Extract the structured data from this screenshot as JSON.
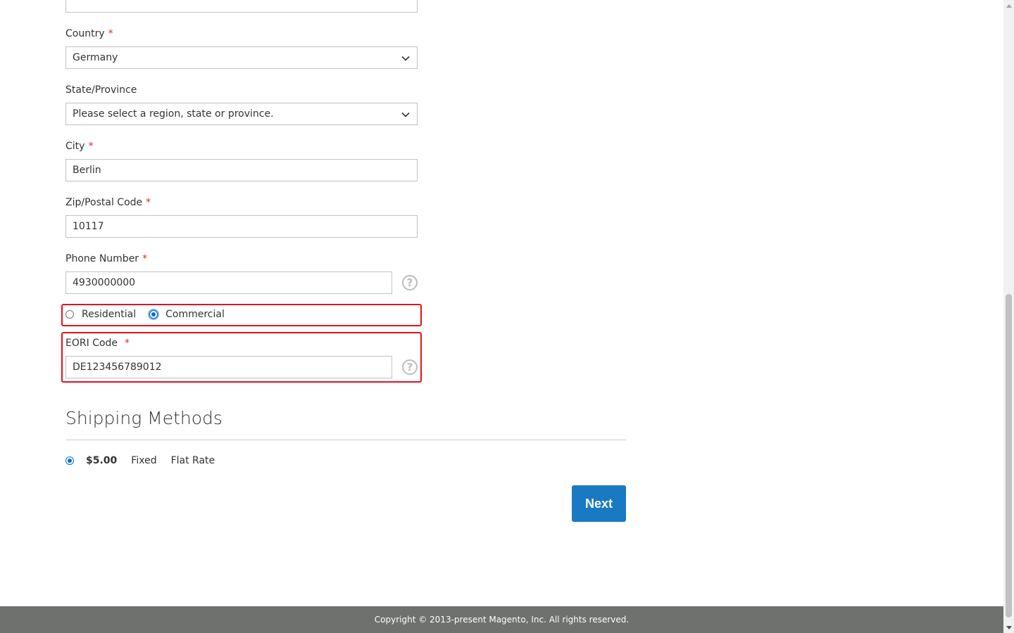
{
  "form": {
    "top_input_value": "",
    "country": {
      "label": "Country",
      "required_mark": "*",
      "value": "Germany"
    },
    "state": {
      "label": "State/Province",
      "value": "Please select a region, state or province."
    },
    "city": {
      "label": "City",
      "required_mark": "*",
      "value": "Berlin"
    },
    "zip": {
      "label": "Zip/Postal Code",
      "required_mark": "*",
      "value": "10117"
    },
    "phone": {
      "label": "Phone Number",
      "required_mark": "*",
      "value": "4930000000",
      "help_glyph": "?"
    },
    "address_type": {
      "options": [
        "Residential",
        "Commercial"
      ],
      "selected": "Commercial"
    },
    "eori": {
      "label": "EORI Code",
      "required_mark": "*",
      "value": "DE123456789012",
      "help_glyph": "?"
    }
  },
  "shipping": {
    "title": "Shipping Methods",
    "methods": [
      {
        "price": "$5.00",
        "method": "Fixed",
        "carrier": "Flat Rate",
        "selected": true
      }
    ]
  },
  "actions": {
    "next_label": "Next"
  },
  "footer": {
    "copyright": "Copyright © 2013-present Magento, Inc. All rights reserved."
  },
  "colors": {
    "primary": "#1979c3",
    "required": "#e02b27",
    "highlight": "#e0121e",
    "footer_bg": "#6e716e"
  },
  "icons": {
    "dropdown": "chevron-down-icon",
    "help": "question-circle-icon"
  }
}
